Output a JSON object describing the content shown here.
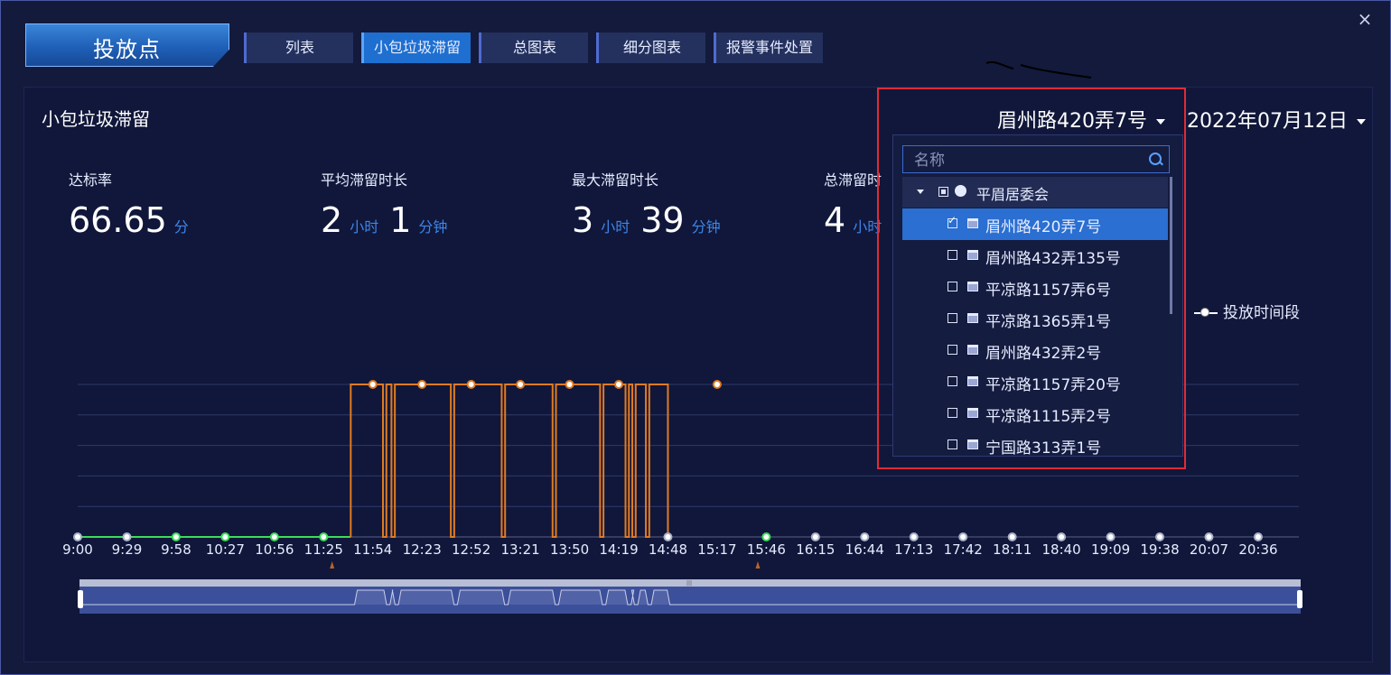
{
  "window": {
    "title": "投放点",
    "close_glyph": "×"
  },
  "nav_tabs": [
    {
      "label": "列表",
      "active": false
    },
    {
      "label": "小包垃圾滞留",
      "active": true
    },
    {
      "label": "总图表",
      "active": false
    },
    {
      "label": "细分图表",
      "active": false
    },
    {
      "label": "报警事件处置",
      "active": false
    }
  ],
  "panel": {
    "title": "小包垃圾滞留"
  },
  "stats": [
    {
      "label": "达标率",
      "parts": [
        {
          "num": "66.65",
          "unit": "分"
        }
      ]
    },
    {
      "label": "平均滞留时长",
      "parts": [
        {
          "num": "2",
          "unit": "小时"
        },
        {
          "num": "1",
          "unit": "分钟"
        }
      ]
    },
    {
      "label": "最大滞留时长",
      "parts": [
        {
          "num": "3",
          "unit": "小时"
        },
        {
          "num": "39",
          "unit": "分钟"
        }
      ]
    },
    {
      "label": "总滞留时",
      "parts": [
        {
          "num": "4",
          "unit": "小时"
        }
      ]
    }
  ],
  "selectors": {
    "location": "眉州路420弄7号",
    "date": "2022年07月12日"
  },
  "legend": {
    "label": "投放时间段"
  },
  "dropdown": {
    "search_placeholder": "名称",
    "group": {
      "label": "平眉居委会",
      "icon": "globe-icon"
    },
    "items": [
      {
        "label": "眉州路420弄7号",
        "checked": true
      },
      {
        "label": "眉州路432弄135号",
        "checked": false
      },
      {
        "label": "平凉路1157弄6号",
        "checked": false
      },
      {
        "label": "平凉路1365弄1号",
        "checked": false
      },
      {
        "label": "眉州路432弄2号",
        "checked": false
      },
      {
        "label": "平凉路1157弄20号",
        "checked": false
      },
      {
        "label": "平凉路1115弄2号",
        "checked": false
      },
      {
        "label": "宁国路313弄1号",
        "checked": false
      }
    ]
  },
  "colors": {
    "accent": "#1e6fd0",
    "line_orange": "#e07b22",
    "point_green": "#3ddc5a",
    "highlight_red": "#e02b35"
  },
  "chart_data": {
    "type": "line",
    "x_ticks": [
      "9:00",
      "9:29",
      "9:58",
      "10:27",
      "10:56",
      "11:25",
      "11:54",
      "12:23",
      "12:52",
      "13:21",
      "13:50",
      "14:19",
      "14:48",
      "15:17",
      "15:46",
      "16:15",
      "16:44",
      "17:13",
      "17:42",
      "18:11",
      "18:40",
      "19:09",
      "19:38",
      "20:07",
      "20:36"
    ],
    "range_minutes": [
      540,
      1260
    ],
    "high_segments": [
      [
        701,
        720
      ],
      [
        722,
        725
      ],
      [
        727,
        760
      ],
      [
        762,
        790
      ],
      [
        792,
        820
      ],
      [
        822,
        848
      ],
      [
        850,
        863
      ],
      [
        865,
        867
      ],
      [
        869,
        875
      ],
      [
        877,
        888
      ]
    ],
    "tick_points": [
      {
        "t": "9:00",
        "status": "white"
      },
      {
        "t": "9:29",
        "status": "white"
      },
      {
        "t": "9:58",
        "status": "green"
      },
      {
        "t": "10:27",
        "status": "green"
      },
      {
        "t": "10:56",
        "status": "green"
      },
      {
        "t": "11:25",
        "status": "green"
      },
      {
        "t": "14:48",
        "status": "white"
      },
      {
        "t": "15:46",
        "status": "green"
      },
      {
        "t": "16:15",
        "status": "white"
      },
      {
        "t": "16:44",
        "status": "white"
      },
      {
        "t": "17:13",
        "status": "white"
      },
      {
        "t": "17:42",
        "status": "white"
      },
      {
        "t": "18:11",
        "status": "white"
      },
      {
        "t": "18:40",
        "status": "white"
      },
      {
        "t": "19:09",
        "status": "white"
      },
      {
        "t": "19:38",
        "status": "white"
      },
      {
        "t": "20:07",
        "status": "white"
      },
      {
        "t": "20:36",
        "status": "white"
      }
    ],
    "high_points": [
      "11:54",
      "12:23",
      "12:52",
      "13:21",
      "13:50",
      "14:19",
      "15:17"
    ],
    "markers": [
      "11:30",
      "15:41"
    ]
  }
}
